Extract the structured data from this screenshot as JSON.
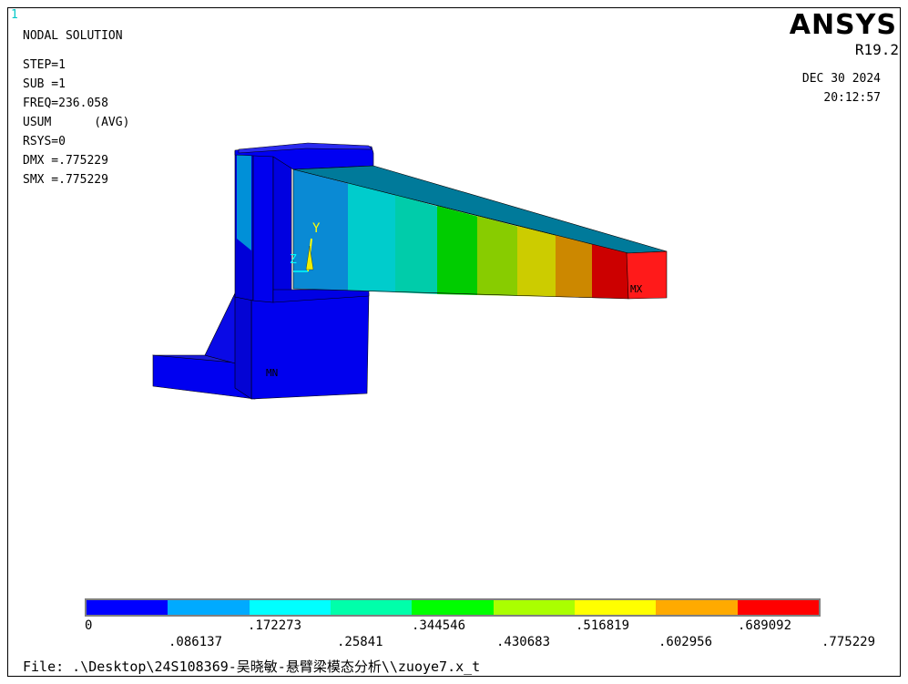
{
  "window": {
    "number": "1"
  },
  "header": {
    "title": "NODAL SOLUTION",
    "step": "STEP=1",
    "sub": "SUB =1",
    "freq": "FREQ=236.058",
    "usum": "USUM      (AVG)",
    "rsys": "RSYS=0",
    "dmx": "DMX =.775229",
    "smx": "SMX =.775229"
  },
  "brand": {
    "name": "ANSYS",
    "version": "R19.2"
  },
  "timestamp": {
    "date": "DEC 30 2024",
    "time": "20:12:57"
  },
  "model": {
    "axis_y": "Y",
    "axis_z": "Z",
    "min_label": "MN",
    "max_label": "MX"
  },
  "legend": {
    "colors": [
      "#0000ff",
      "#00aaff",
      "#00ffff",
      "#00ffaa",
      "#00ff00",
      "#aaff00",
      "#ffff00",
      "#ffaa00",
      "#ff0000"
    ],
    "labels_top": [
      "0",
      ".172273",
      ".344546",
      ".516819",
      ".689092"
    ],
    "labels_bottom": [
      ".086137",
      ".25841",
      ".430683",
      ".602956",
      ".775229"
    ]
  },
  "footer": {
    "file": "File: .\\Desktop\\24S108369-吴晓敏-悬臂梁模态分析\\\\zuoye7.x_t"
  }
}
